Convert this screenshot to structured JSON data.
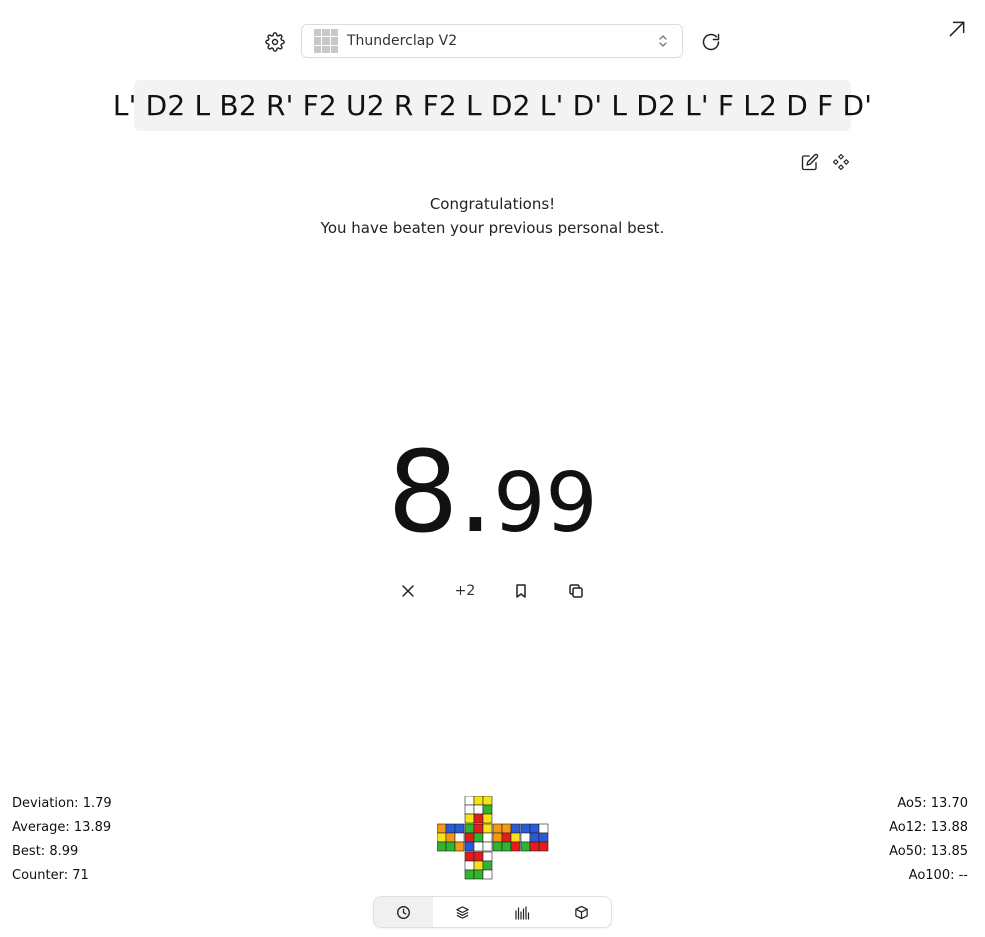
{
  "header": {
    "puzzle_name": "Thunderclap V2"
  },
  "scramble": {
    "text": "L' D2 L B2 R' F2 U2 R F2 L D2 L' D' L D2 L' F L2 D F D'"
  },
  "message": {
    "line1": "Congratulations!",
    "line2": "You have beaten your previous personal best."
  },
  "timer": {
    "seconds": "8",
    "separator": ".",
    "fraction": "99"
  },
  "actions": {
    "plus_two_label": "+2"
  },
  "stats_left": [
    {
      "label": "Deviation:",
      "value": "1.79"
    },
    {
      "label": "Average:",
      "value": "13.89"
    },
    {
      "label": "Best:",
      "value": "8.99"
    },
    {
      "label": "Counter:",
      "value": "71"
    }
  ],
  "stats_right": [
    {
      "label": "Ao5:",
      "value": "13.70"
    },
    {
      "label": "Ao12:",
      "value": "13.88"
    },
    {
      "label": "Ao50:",
      "value": "13.85"
    },
    {
      "label": "Ao100:",
      "value": "--"
    }
  ],
  "colors": {
    "cube_white": "#ffffff",
    "cube_yellow": "#f5e31a",
    "cube_green": "#2fb52f",
    "cube_blue": "#2a5bd7",
    "cube_red": "#e61b1b",
    "cube_orange": "#f39a12"
  },
  "cube_net": {
    "U": [
      "W",
      "Y",
      "Y",
      "W",
      "W",
      "G",
      "Y",
      "R",
      "Y"
    ],
    "L": [
      "O",
      "B",
      "B",
      "Y",
      "O",
      "W",
      "G",
      "G",
      "O"
    ],
    "F": [
      "G",
      "R",
      "Y",
      "R",
      "G",
      "W",
      "B",
      "W",
      "W"
    ],
    "R": [
      "O",
      "O",
      "B",
      "O",
      "R",
      "Y",
      "G",
      "G",
      "R"
    ],
    "B": [
      "B",
      "B",
      "W",
      "W",
      "B",
      "B",
      "G",
      "R",
      "R"
    ],
    "D": [
      "R",
      "R",
      "W",
      "W",
      "Y",
      "G",
      "G",
      "G",
      "W"
    ]
  },
  "bottom_nav": {
    "tabs": [
      "timer-tab",
      "sessions-tab",
      "stats-tab",
      "cube-tab"
    ],
    "active": "timer-tab"
  }
}
